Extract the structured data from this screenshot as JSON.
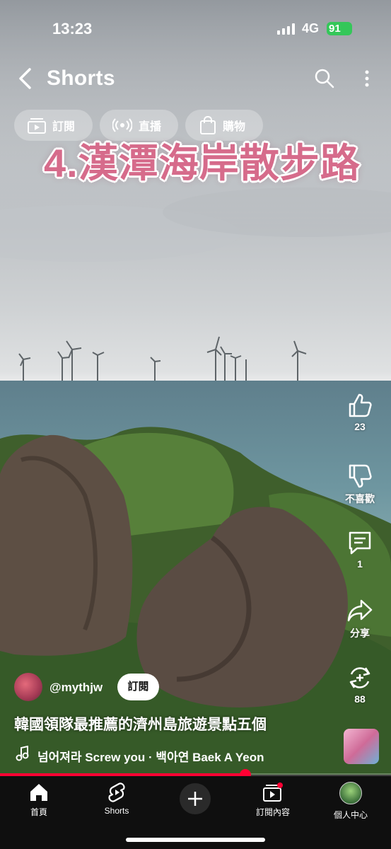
{
  "status_bar": {
    "time": "13:23",
    "network": "4G",
    "battery": "91"
  },
  "header": {
    "title": "Shorts"
  },
  "chips": [
    {
      "label": "訂閱",
      "icon": "subscriptions-icon"
    },
    {
      "label": "直播",
      "icon": "live-icon"
    },
    {
      "label": "購物",
      "icon": "shopping-bag-icon"
    }
  ],
  "video": {
    "overlay_text": "4.漢潭海岸散步路"
  },
  "actions": {
    "like_count": "23",
    "dislike_label": "不喜歡",
    "comment_count": "1",
    "share_label": "分享",
    "remix_count": "88"
  },
  "channel": {
    "handle": "@mythjw",
    "subscribe_label": "訂閱"
  },
  "video_title": "韓國領隊最推薦的濟州島旅遊景點五個",
  "music": {
    "text": "넘어져라 Screw you · 백아연 Baek A Yeon"
  },
  "playback": {
    "progress": 0.627
  },
  "nav": {
    "home": "首頁",
    "shorts": "Shorts",
    "subscriptions": "訂閱內容",
    "profile": "個人中心"
  },
  "colors": {
    "accent": "#ff0033",
    "overlay_text": "#d66b8b",
    "battery": "#34c759"
  }
}
